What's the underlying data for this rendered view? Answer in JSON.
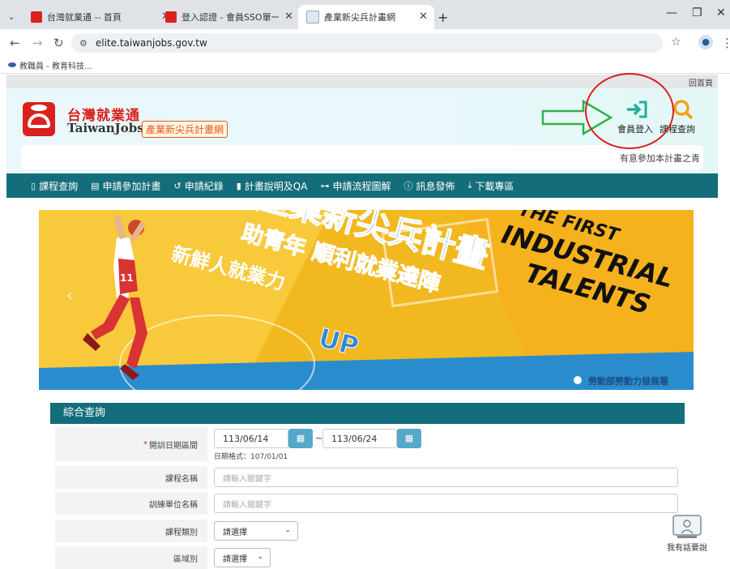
{
  "browser": {
    "tabs": [
      {
        "title": "台灣就業通 -- 首頁",
        "active": false
      },
      {
        "title": "登入認證 - 會員SSO單一登入 -",
        "active": false
      },
      {
        "title": "產業新尖兵計畫網",
        "active": true
      }
    ],
    "new_tab": "+",
    "url": "elite.taiwanjobs.gov.tw",
    "bookmark": "教職員 - 教育科技..."
  },
  "page": {
    "top_link": "回首頁",
    "logo_zh": "台灣就業通",
    "logo_en": "TaiwanJobs",
    "logo_sub": "產業新尖兵計畫網",
    "marquee": "有意參加本計畫之青",
    "login_label": "會員登入",
    "course_search_label": "課程查詢",
    "colors": {
      "teal": "#146d7a",
      "brand_red": "#d9211d",
      "login_green": "#1fb29a",
      "search_orange": "#f4a21a"
    },
    "nav": [
      {
        "icon": "document-icon",
        "label": "課程查詢"
      },
      {
        "icon": "list-icon",
        "label": "申請參加計畫"
      },
      {
        "icon": "history-icon",
        "label": "申請紀錄"
      },
      {
        "icon": "file-icon",
        "label": "計畫說明及QA"
      },
      {
        "icon": "flowchart-icon",
        "label": "申請流程圖解"
      },
      {
        "icon": "info-icon",
        "label": "訊息發佈"
      },
      {
        "icon": "download-icon",
        "label": "下載專區"
      }
    ]
  },
  "banner": {
    "title_zh": "產業新尖兵計畫",
    "subtitle1": "助青年 順利就業達陣",
    "subtitle2": "新鮮人就業力",
    "up": "UP",
    "en_line1": "THE FIRST",
    "en_line2": "INDUSTRIAL",
    "en_line3": "TALENTS",
    "agency": "勞動部勞動力發展署",
    "player_number": "11"
  },
  "form": {
    "header": "綜合查詢",
    "required_mark": "*",
    "date_label": "開訓日期區間",
    "date_from": "113/06/14",
    "date_sep": "~",
    "date_to": "113/06/24",
    "date_hint": "日期格式：107/01/01",
    "course_name_label": "課程名稱",
    "course_name_placeholder": "請輸入關鍵字",
    "unit_label": "訓練單位名稱",
    "unit_placeholder": "請輸入關鍵字",
    "category_label": "課程類別",
    "category_value": "請選擇",
    "region_label": "區域別",
    "region_value": "請選擇"
  },
  "feedback_label": "我有話要說"
}
